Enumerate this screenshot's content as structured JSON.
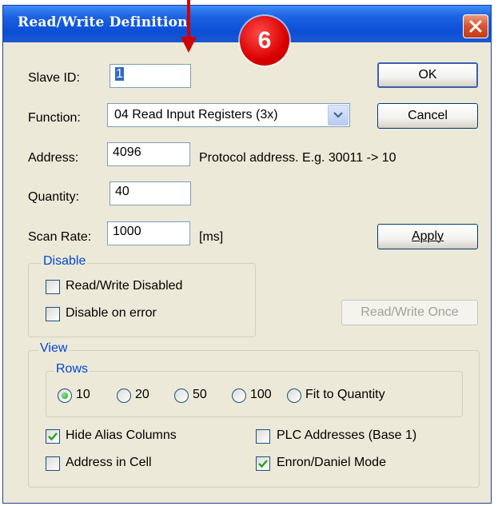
{
  "window": {
    "title": "Read/Write Definition"
  },
  "annotation": {
    "badge": "6"
  },
  "fields": {
    "slave_id": {
      "label": "Slave ID:",
      "value": "1"
    },
    "function": {
      "label": "Function:",
      "value": "04 Read Input Registers (3x)"
    },
    "address": {
      "label": "Address:",
      "value": "4096",
      "hint": "Protocol address. E.g. 30011 -> 10"
    },
    "quantity": {
      "label": "Quantity:",
      "value": "40"
    },
    "scan_rate": {
      "label": "Scan Rate:",
      "value": "1000",
      "unit": "[ms]"
    }
  },
  "buttons": {
    "ok": "OK",
    "cancel": "Cancel",
    "apply": "Apply",
    "read_write_once": "Read/Write Once"
  },
  "disable_group": {
    "title": "Disable",
    "read_write_disabled": {
      "label": "Read/Write Disabled",
      "checked": false
    },
    "disable_on_error": {
      "label": "Disable on error",
      "checked": false
    }
  },
  "view_group": {
    "title": "View",
    "rows_title": "Rows",
    "rows_options": [
      "10",
      "20",
      "50",
      "100",
      "Fit to Quantity"
    ],
    "rows_selected": "10",
    "hide_alias_columns": {
      "label": "Hide Alias Columns",
      "checked": true
    },
    "plc_addresses": {
      "label": "PLC Addresses (Base 1)",
      "checked": false
    },
    "address_in_cell": {
      "label": "Address in Cell",
      "checked": false
    },
    "enron_daniel_mode": {
      "label": "Enron/Daniel Mode",
      "checked": true
    }
  },
  "colors": {
    "title_bar": "#0b4fd6",
    "dialog_bg": "#ece9d8",
    "group_title": "#0046d5",
    "badge": "#d90000"
  }
}
